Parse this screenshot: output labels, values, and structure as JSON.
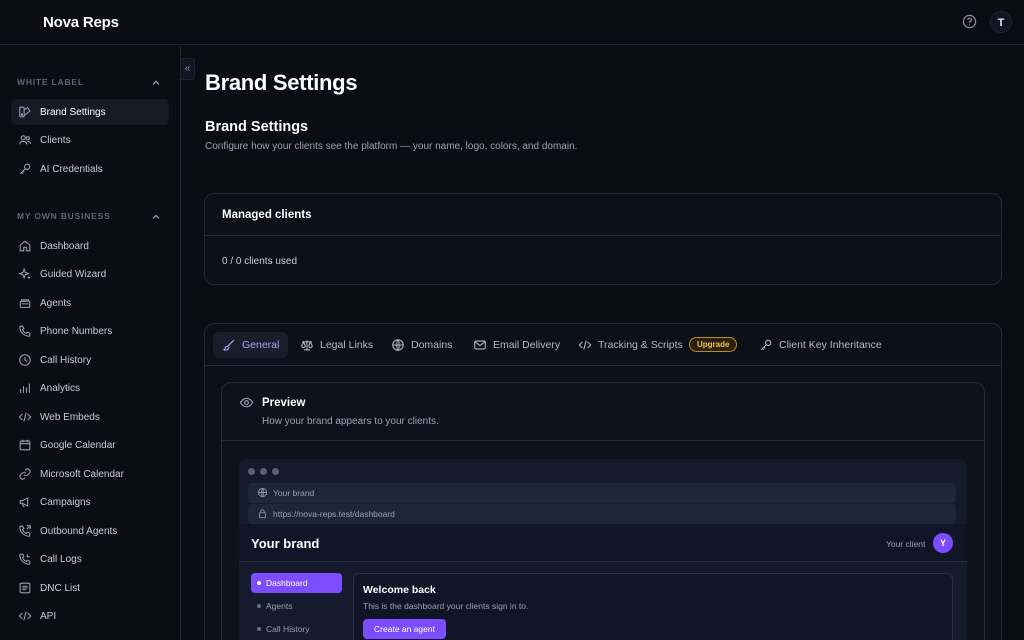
{
  "app": {
    "name": "Nova Reps",
    "user_initial": "T"
  },
  "sidebar": {
    "sections": [
      {
        "label": "WHITE LABEL",
        "items": [
          {
            "label": "Brand Settings",
            "icon": "brand-icon",
            "active": true
          },
          {
            "label": "Clients",
            "icon": "users-icon"
          },
          {
            "label": "AI Credentials",
            "icon": "key-icon"
          }
        ]
      },
      {
        "label": "MY OWN BUSINESS",
        "items": [
          {
            "label": "Dashboard",
            "icon": "home-icon"
          },
          {
            "label": "Guided Wizard",
            "icon": "sparkle-icon"
          },
          {
            "label": "Agents",
            "icon": "agents-icon"
          },
          {
            "label": "Phone Numbers",
            "icon": "phone-icon"
          },
          {
            "label": "Call History",
            "icon": "clock-icon"
          },
          {
            "label": "Analytics",
            "icon": "chart-icon"
          },
          {
            "label": "Web Embeds",
            "icon": "code-icon"
          },
          {
            "label": "Google Calendar",
            "icon": "calendar-icon"
          },
          {
            "label": "Microsoft Calendar",
            "icon": "link-icon"
          },
          {
            "label": "Campaigns",
            "icon": "megaphone-icon"
          },
          {
            "label": "Outbound Agents",
            "icon": "phone-outgoing-icon"
          },
          {
            "label": "Call Logs",
            "icon": "phone-log-icon"
          },
          {
            "label": "DNC List",
            "icon": "list-icon"
          },
          {
            "label": "API",
            "icon": "code-icon"
          }
        ]
      }
    ],
    "collapse_glyph": "«"
  },
  "main": {
    "page_title": "Brand Settings",
    "section_title": "Brand Settings",
    "section_subtitle": "Configure how your clients see the platform — your name, logo, colors, and domain.",
    "managed": {
      "title": "Managed clients",
      "usage": "0 / 0 clients used"
    },
    "tabs": [
      {
        "label": "General",
        "icon": "brush-icon",
        "active": true
      },
      {
        "label": "Legal Links",
        "icon": "scale-icon"
      },
      {
        "label": "Domains",
        "icon": "globe-icon"
      },
      {
        "label": "Email Delivery",
        "icon": "mail-icon"
      },
      {
        "label": "Tracking & Scripts",
        "icon": "code-icon",
        "badge": "Upgrade"
      },
      {
        "label": "Client Key Inheritance",
        "icon": "key-icon"
      }
    ],
    "preview": {
      "title": "Preview",
      "subtitle": "How your brand appears to your clients.",
      "browser": {
        "tab_title": "Your brand",
        "url": "https://nova-reps.test/dashboard",
        "app_brand": "Your brand",
        "client_label": "Your client",
        "client_initial": "Y",
        "nav": [
          "Dashboard",
          "Agents",
          "Call History"
        ],
        "welcome_title": "Welcome back",
        "welcome_sub": "This is the dashboard your clients sign in to.",
        "cta": "Create an agent"
      }
    }
  },
  "colors": {
    "accent": "#7c4dff",
    "accent_text": "#b79cff",
    "badge": "#f2c24c",
    "background": "#0b0d14"
  }
}
